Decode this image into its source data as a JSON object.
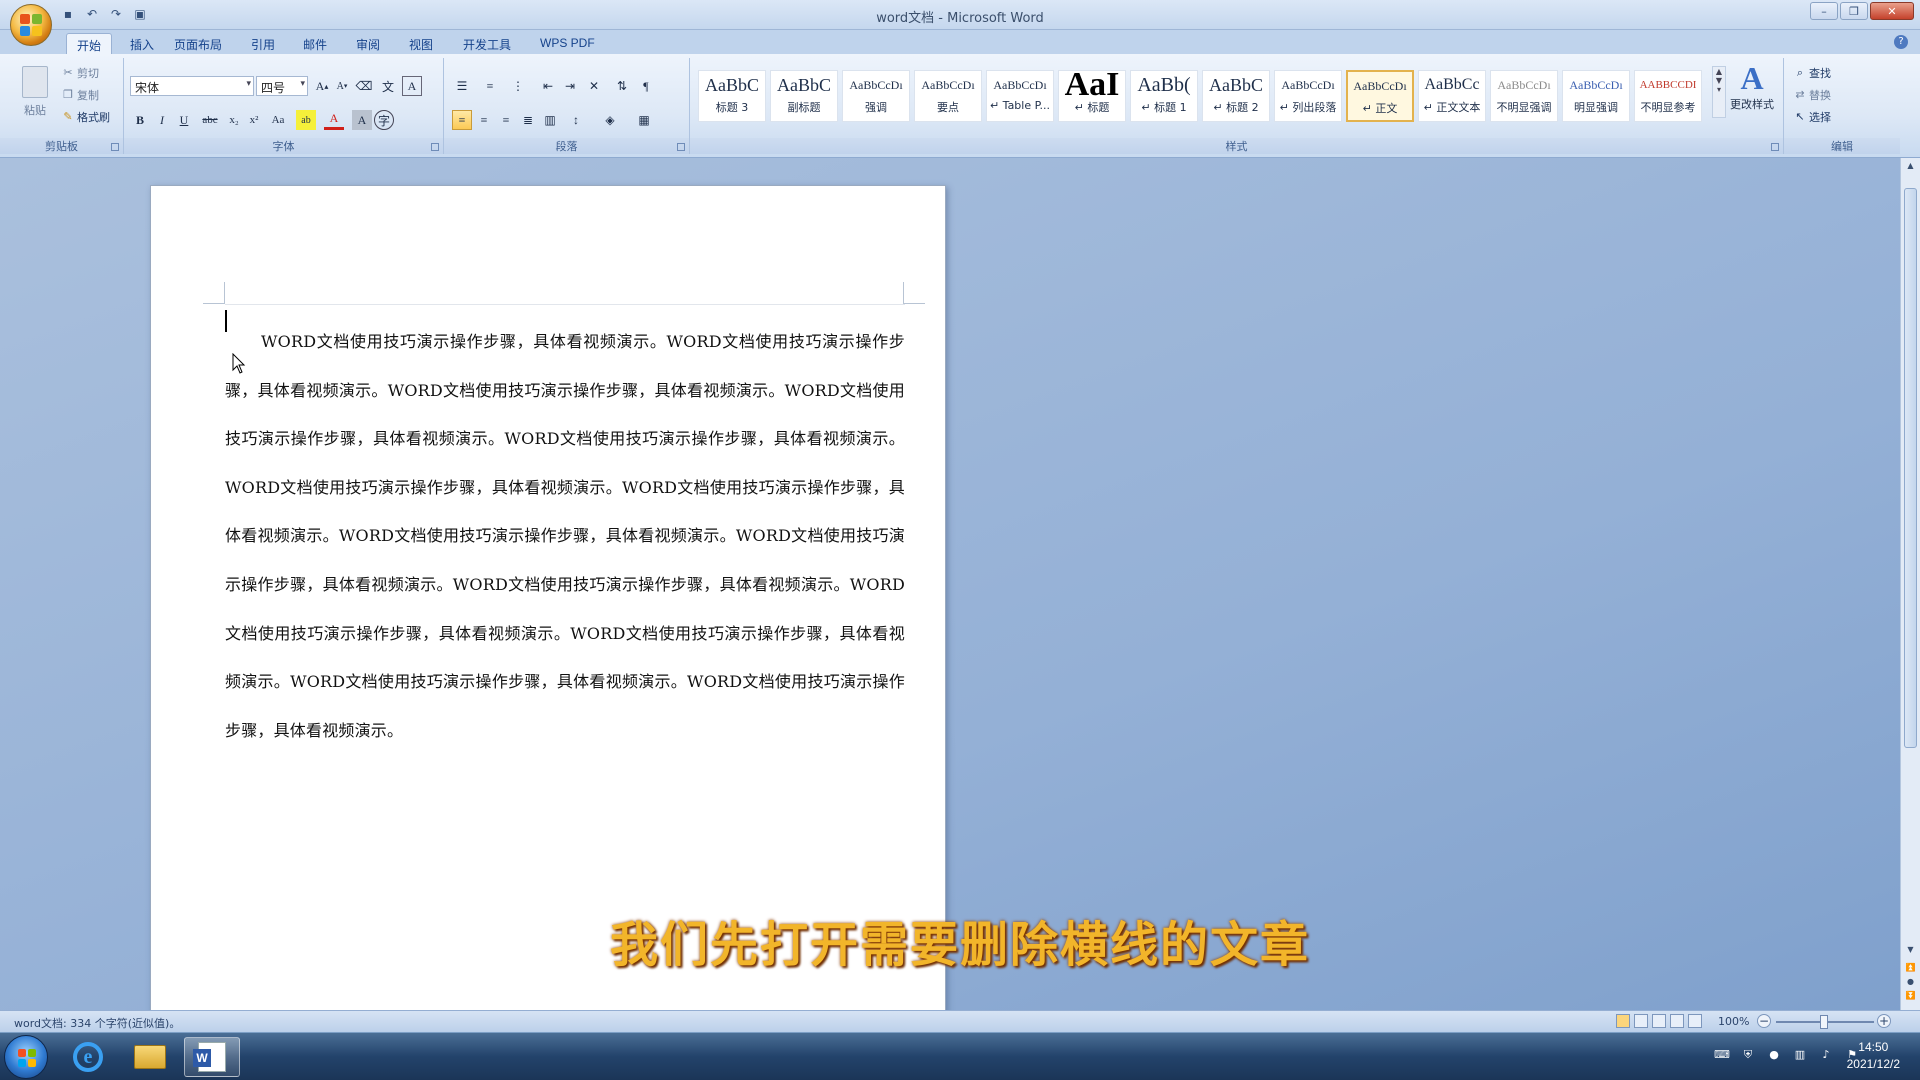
{
  "window": {
    "title": "word文档 - Microsoft Word"
  },
  "tabs": [
    "开始",
    "插入",
    "页面布局",
    "引用",
    "邮件",
    "审阅",
    "视图",
    "开发工具",
    "WPS PDF"
  ],
  "clipboard": {
    "paste": "粘贴",
    "cut": "剪切",
    "copy": "复制",
    "format_painter": "格式刷",
    "label": "剪贴板"
  },
  "font": {
    "name": "宋体",
    "size": "四号",
    "label": "字体"
  },
  "paragraph": {
    "label": "段落"
  },
  "styles": {
    "label": "样式",
    "items": [
      {
        "preview": "AaBbC",
        "name": "标题 3"
      },
      {
        "preview": "AaBbC",
        "name": "副标题"
      },
      {
        "preview": "AaBbCcDı",
        "name": "强调"
      },
      {
        "preview": "AaBbCcDı",
        "name": "要点"
      },
      {
        "preview": "AaBbCcDı",
        "name": "↵ Table P..."
      },
      {
        "preview": "AaI",
        "name": "↵ 标题"
      },
      {
        "preview": "AaBb(",
        "name": "↵ 标题 1"
      },
      {
        "preview": "AaBbC",
        "name": "↵ 标题 2"
      },
      {
        "preview": "AaBbCcDı",
        "name": "↵ 列出段落"
      },
      {
        "preview": "AaBbCcDı",
        "name": "↵ 正文"
      },
      {
        "preview": "AaBbCc",
        "name": "↵ 正文文本"
      },
      {
        "preview": "AaBbCcDı",
        "name": "不明显强调"
      },
      {
        "preview": "AaBbCcDı",
        "name": "明显强调"
      },
      {
        "preview": "AABBCCDI",
        "name": "不明显参考"
      }
    ],
    "selected_index": 9,
    "change_styles": "更改样式"
  },
  "editing": {
    "find": "查找",
    "replace": "替换",
    "select": "选择",
    "label": "编辑"
  },
  "document": {
    "body": "WORD文档使用技巧演示操作步骤，具体看视频演示。WORD文档使用技巧演示操作步骤，具体看视频演示。WORD文档使用技巧演示操作步骤，具体看视频演示。WORD文档使用技巧演示操作步骤，具体看视频演示。WORD文档使用技巧演示操作步骤，具体看视频演示。WORD文档使用技巧演示操作步骤，具体看视频演示。WORD文档使用技巧演示操作步骤，具体看视频演示。WORD文档使用技巧演示操作步骤，具体看视频演示。WORD文档使用技巧演示操作步骤，具体看视频演示。WORD文档使用技巧演示操作步骤，具体看视频演示。WORD文档使用技巧演示操作步骤，具体看视频演示。WORD文档使用技巧演示操作步骤，具体看视频演示。WORD文档使用技巧演示操作步骤，具体看视频演示。WORD文档使用技巧演示操作步骤，具体看视频演示。"
  },
  "subtitle": "我们先打开需要删除横线的文章",
  "status": {
    "text": "word文档: 334 个字符(近似值)。",
    "zoom": "100%"
  },
  "clock": {
    "time": "14:50",
    "date": "2021/12/2"
  },
  "colors": {
    "accent": "#15428b",
    "subtitle": "#f2b52a"
  }
}
